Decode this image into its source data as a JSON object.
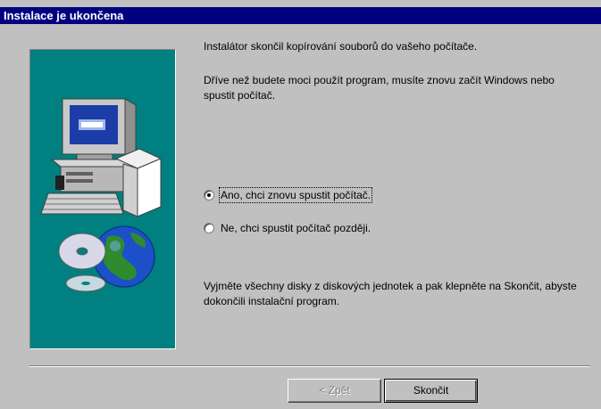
{
  "window": {
    "title": "Instalace je ukončena"
  },
  "content": {
    "message_1": "Instalátor skončil  kopírování souborů do vašeho počítače.",
    "message_2": "Dříve než budete moci použít program, musíte znovu začít Windows nebo spustit počítač.",
    "message_3": "Vyjměte všechny disky z diskových jednotek a pak klepněte na Skončit, abyste dokončili instalační program."
  },
  "options": [
    {
      "label": "Ano, chci znovu spustit počítač.",
      "checked": true
    },
    {
      "label": "Ne, chci spustit počítač později.",
      "checked": false
    }
  ],
  "buttons": {
    "back_label": "< Zpět",
    "finish_label": "Skončit"
  },
  "colors": {
    "titlebar": "#000080",
    "panel": "#008080",
    "dialog": "#c0c0c0"
  },
  "icons": {
    "side_graphic": "computer-with-cds-and-globe-illustration"
  }
}
